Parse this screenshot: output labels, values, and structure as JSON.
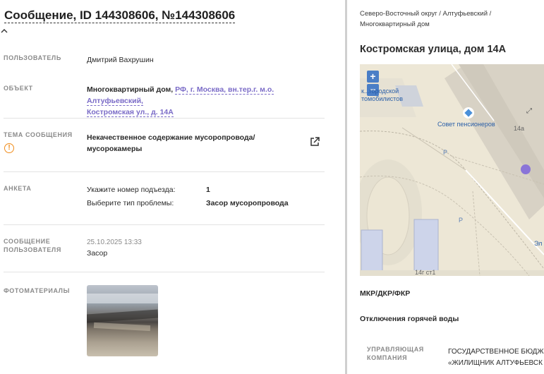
{
  "header": {
    "title": "Сообщение, ID 144308606, №144308606"
  },
  "fields": {
    "user_label": "Пользователь",
    "user_value": "Дмитрий Вахрушин",
    "object_label": "Объект",
    "object_type": "Многоквартирный дом,",
    "object_link_line1": "РФ, г. Москва, вн.тер.г. м.о. Алтуфьевский,",
    "object_link_line2": "Костромская ул., д. 14А",
    "topic_label": "Тема сообщения",
    "topic_line1": "Некачественное содержание мусоропровода/",
    "topic_line2": "мусорокамеры",
    "survey_label": "Анкета",
    "survey_q1": "Укажите номер подъезда:",
    "survey_a1": "1",
    "survey_q2": "Выберите тип проблемы:",
    "survey_a2": "Засор мусоропровода",
    "message_label_line1": "Сообщение",
    "message_label_line2": "пользователя",
    "message_datetime": "25.10.2025 13:33",
    "message_text": "Засор",
    "photos_label": "Фотоматериалы"
  },
  "right": {
    "breadcrumb_line1": "Северо-Восточный округ / Алтуфьевский /",
    "breadcrumb_line2": "Многоквартирный дом",
    "address": "Костромская улица, дом 14А",
    "map": {
      "zoom_in": "+",
      "zoom_out": "−",
      "label_school_1": "к...городской",
      "label_school_2": "томобилистов",
      "label_poi": "Совет пенсионеров",
      "label_house_14a": "14а",
      "label_building": "14г ст1",
      "label_edge": "Эл",
      "label_parking_1": "P",
      "label_parking_2": "P"
    },
    "section_mkr": "МКР/ДКР/ФКР",
    "section_hot_water": "Отключения горячей воды",
    "uk_label_line1": "Управляющая",
    "uk_label_line2": "компания",
    "uk_value_line1": "ГОСУДАРСТВЕННОЕ БЮДЖЕ",
    "uk_value_line2": "«ЖИЛИЩНИК АЛТУФЬЕВСК"
  },
  "colors": {
    "accent_link": "#7a6bc7",
    "warning": "#f08c1a",
    "map_zoom": "#4a7ec6"
  }
}
